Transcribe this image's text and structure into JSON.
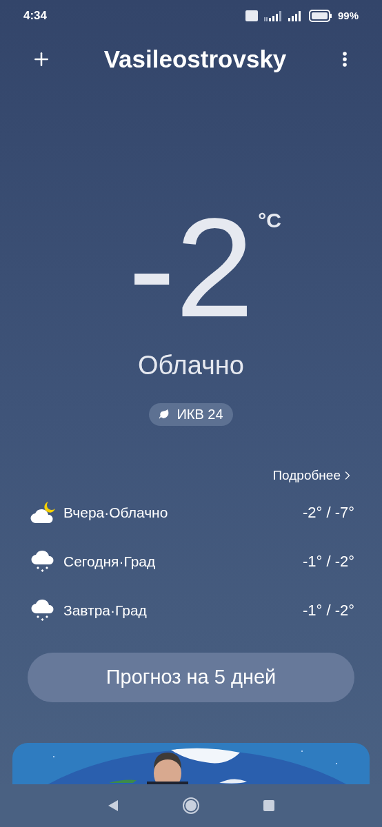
{
  "status_bar": {
    "time": "4:34",
    "battery": "99%"
  },
  "header": {
    "city": "Vasileostrovsky"
  },
  "current": {
    "temperature": "-2",
    "unit": "°C",
    "condition": "Облачно",
    "aqi": "ИКВ 24"
  },
  "forecast": {
    "more_link": "Подробнее",
    "days": [
      {
        "kind": "cloudy_night",
        "label": "Вчера·Облачно",
        "range": "-2° / -7°"
      },
      {
        "kind": "hail",
        "label": "Сегодня·Град",
        "range": "-1° / -2°"
      },
      {
        "kind": "hail",
        "label": "Завтра·Град",
        "range": "-1° / -2°"
      }
    ]
  },
  "forecast_button": "Прогноз на 5 дней"
}
